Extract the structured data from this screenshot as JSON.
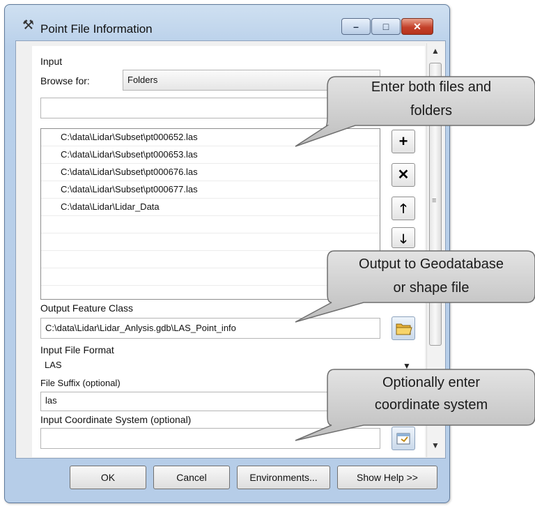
{
  "window": {
    "title": "Point File Information",
    "tool_icon": "hammer-icon",
    "controls": {
      "minimize": "–",
      "maximize": "□",
      "close": "✕"
    }
  },
  "form": {
    "input_label": "Input",
    "browse_label": "Browse for:",
    "browse_value": "Folders",
    "path_value": "",
    "input_items": [
      "C:\\data\\Lidar\\Subset\\pt000652.las",
      "C:\\data\\Lidar\\Subset\\pt000653.las",
      "C:\\data\\Lidar\\Subset\\pt000676.las",
      "C:\\data\\Lidar\\Subset\\pt000677.las",
      "C:\\data\\Lidar\\Lidar_Data"
    ],
    "list_buttons": {
      "add": "+",
      "remove": "✕",
      "up": "🡑",
      "down": "🡓"
    },
    "output_label": "Output Feature Class",
    "output_value": "C:\\data\\Lidar\\Lidar_Anlysis.gdb\\LAS_Point_info",
    "format_label": "Input File Format",
    "format_value": "LAS",
    "suffix_label": "File Suffix (optional)",
    "suffix_value": "las",
    "coord_label": "Input Coordinate System (optional)",
    "coord_value": ""
  },
  "buttons": {
    "ok": "OK",
    "cancel": "Cancel",
    "environments": "Environments...",
    "show_help": "Show Help >>"
  },
  "callouts": {
    "files_folders_line1": "Enter both files and",
    "files_folders_line2": "folders",
    "output_line1": "Output to Geodatabase",
    "output_line2": "or shape file",
    "coord_line1": "Optionally enter",
    "coord_line2": "coordinate system"
  },
  "colors": {
    "window_frame": "#b9d0ea",
    "close_button": "#c4412b",
    "callout_fill": "#cfcfcf"
  }
}
